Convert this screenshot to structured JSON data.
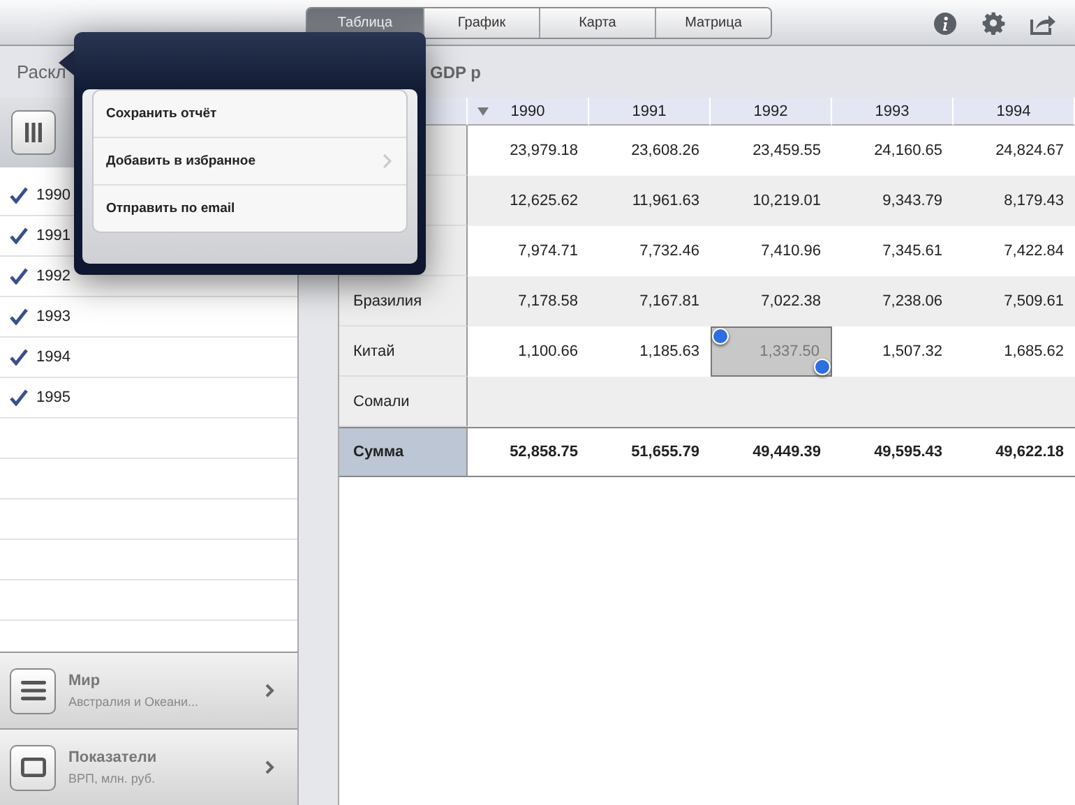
{
  "toolbar": {
    "tabs": [
      {
        "label": "Таблица",
        "selected": true
      },
      {
        "label": "График",
        "selected": false
      },
      {
        "label": "Карта",
        "selected": false
      },
      {
        "label": "Матрица",
        "selected": false
      }
    ]
  },
  "sidebar": {
    "header": "Раскл",
    "items": [
      {
        "label": "1990",
        "checked": true
      },
      {
        "label": "1991",
        "checked": true
      },
      {
        "label": "1992",
        "checked": true
      },
      {
        "label": "1993",
        "checked": true
      },
      {
        "label": "1994",
        "checked": true
      },
      {
        "label": "1995",
        "checked": true
      }
    ],
    "panels": [
      {
        "kind": "list",
        "title": "Мир",
        "subtitle": "Австралия и Океани..."
      },
      {
        "kind": "frame",
        "title": "Показатели",
        "subtitle": "ВРП, млн. руб."
      }
    ]
  },
  "table": {
    "title": "GDP р",
    "columns": [
      {
        "label": "1990",
        "sorted": true
      },
      {
        "label": "1991",
        "sorted": false
      },
      {
        "label": "1992",
        "sorted": false
      },
      {
        "label": "1993",
        "sorted": false
      },
      {
        "label": "1994",
        "sorted": false
      }
    ],
    "rows": [
      {
        "kind": "data",
        "cells": [
          {
            "text": "23,979.18",
            "selected": false
          },
          {
            "text": "23,608.26",
            "selected": false
          },
          {
            "text": "23,459.55",
            "selected": false
          },
          {
            "text": "24,160.65",
            "selected": false
          },
          {
            "text": "24,824.67",
            "selected": false
          }
        ]
      },
      {
        "kind": "data",
        "cells": [
          {
            "text": "12,625.62",
            "selected": false
          },
          {
            "text": "11,961.63",
            "selected": false
          },
          {
            "text": "10,219.01",
            "selected": false
          },
          {
            "text": "9,343.79",
            "selected": false
          },
          {
            "text": "8,179.43",
            "selected": false
          }
        ]
      },
      {
        "kind": "data",
        "cells": [
          {
            "text": "7,974.71",
            "selected": false
          },
          {
            "text": "7,732.46",
            "selected": false
          },
          {
            "text": "7,410.96",
            "selected": false
          },
          {
            "text": "7,345.61",
            "selected": false
          },
          {
            "text": "7,422.84",
            "selected": false
          }
        ]
      },
      {
        "kind": "data",
        "label": "Бразилия",
        "cells": [
          {
            "text": "7,178.58",
            "selected": false
          },
          {
            "text": "7,167.81",
            "selected": false
          },
          {
            "text": "7,022.38",
            "selected": false
          },
          {
            "text": "7,238.06",
            "selected": false
          },
          {
            "text": "7,509.61",
            "selected": false
          }
        ]
      },
      {
        "kind": "data",
        "label": "Китай",
        "cells": [
          {
            "text": "1,100.66",
            "selected": false
          },
          {
            "text": "1,185.63",
            "selected": false
          },
          {
            "text": "1,337.50",
            "selected": true
          },
          {
            "text": "1,507.32",
            "selected": false
          },
          {
            "text": "1,685.62",
            "selected": false
          }
        ]
      },
      {
        "kind": "data",
        "label": "Сомали"
      },
      {
        "kind": "total",
        "label": "Сумма",
        "cells": [
          {
            "text": "52,858.75",
            "selected": false
          },
          {
            "text": "51,655.79",
            "selected": false
          },
          {
            "text": "49,449.39",
            "selected": false
          },
          {
            "text": "49,595.43",
            "selected": false
          },
          {
            "text": "49,622.18",
            "selected": false
          }
        ]
      }
    ]
  },
  "popover": {
    "items": [
      {
        "label": "Сохранить отчёт",
        "has_submenu": false
      },
      {
        "label": "Добавить в избранное",
        "has_submenu": true
      },
      {
        "label": "Отправить по email",
        "has_submenu": false
      }
    ]
  }
}
